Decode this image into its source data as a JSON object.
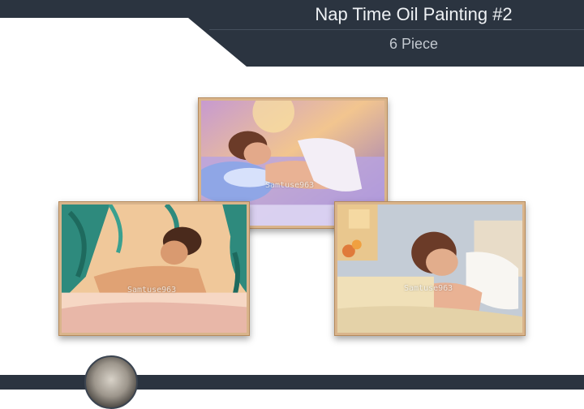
{
  "header": {
    "title": "Nap Time Oil Painting #2",
    "subtitle": "6 Piece"
  },
  "paintings": [
    {
      "watermark": "Samtuse963"
    },
    {
      "watermark": "Samtuse963"
    },
    {
      "watermark": "Samtuse963"
    }
  ],
  "colors": {
    "header_bg": "#2b3440",
    "frame": "#d9b48b",
    "title_text": "#eef1f4"
  }
}
